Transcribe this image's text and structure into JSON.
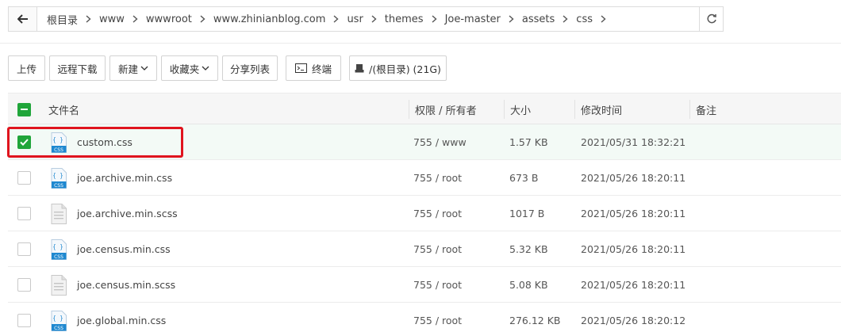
{
  "breadcrumb": [
    "根目录",
    "www",
    "wwwroot",
    "www.zhinianblog.com",
    "usr",
    "themes",
    "Joe-master",
    "assets",
    "css"
  ],
  "toolbar": {
    "upload": "上传",
    "remote_download": "远程下载",
    "new": "新建",
    "favorites": "收藏夹",
    "share_list": "分享列表",
    "terminal": "终端",
    "disk": "/(根目录) (21G)"
  },
  "columns": {
    "filename": "文件名",
    "perm_owner": "权限 / 所有者",
    "size": "大小",
    "modified": "修改时间",
    "note": "备注"
  },
  "files": [
    {
      "name": "custom.css",
      "perm": "755 / www",
      "size": "1.57 KB",
      "modified": "2021/05/31 18:32:21",
      "type": "css",
      "checked": true
    },
    {
      "name": "joe.archive.min.css",
      "perm": "755 / root",
      "size": "673 B",
      "modified": "2021/05/26 18:20:11",
      "type": "css",
      "checked": false
    },
    {
      "name": "joe.archive.min.scss",
      "perm": "755 / root",
      "size": "1017 B",
      "modified": "2021/05/26 18:20:11",
      "type": "doc",
      "checked": false
    },
    {
      "name": "joe.census.min.css",
      "perm": "755 / root",
      "size": "5.32 KB",
      "modified": "2021/05/26 18:20:11",
      "type": "css",
      "checked": false
    },
    {
      "name": "joe.census.min.scss",
      "perm": "755 / root",
      "size": "5.08 KB",
      "modified": "2021/05/26 18:20:11",
      "type": "doc",
      "checked": false
    },
    {
      "name": "joe.global.min.css",
      "perm": "755 / root",
      "size": "276.12 KB",
      "modified": "2021/05/26 18:20:12",
      "type": "css",
      "checked": false
    }
  ],
  "icons": {
    "css_label": "CSS",
    "css_glyph": "{ }"
  },
  "colors": {
    "accent": "#20a53a",
    "highlight": "#e0141e",
    "css_icon": "#1e88d0"
  }
}
